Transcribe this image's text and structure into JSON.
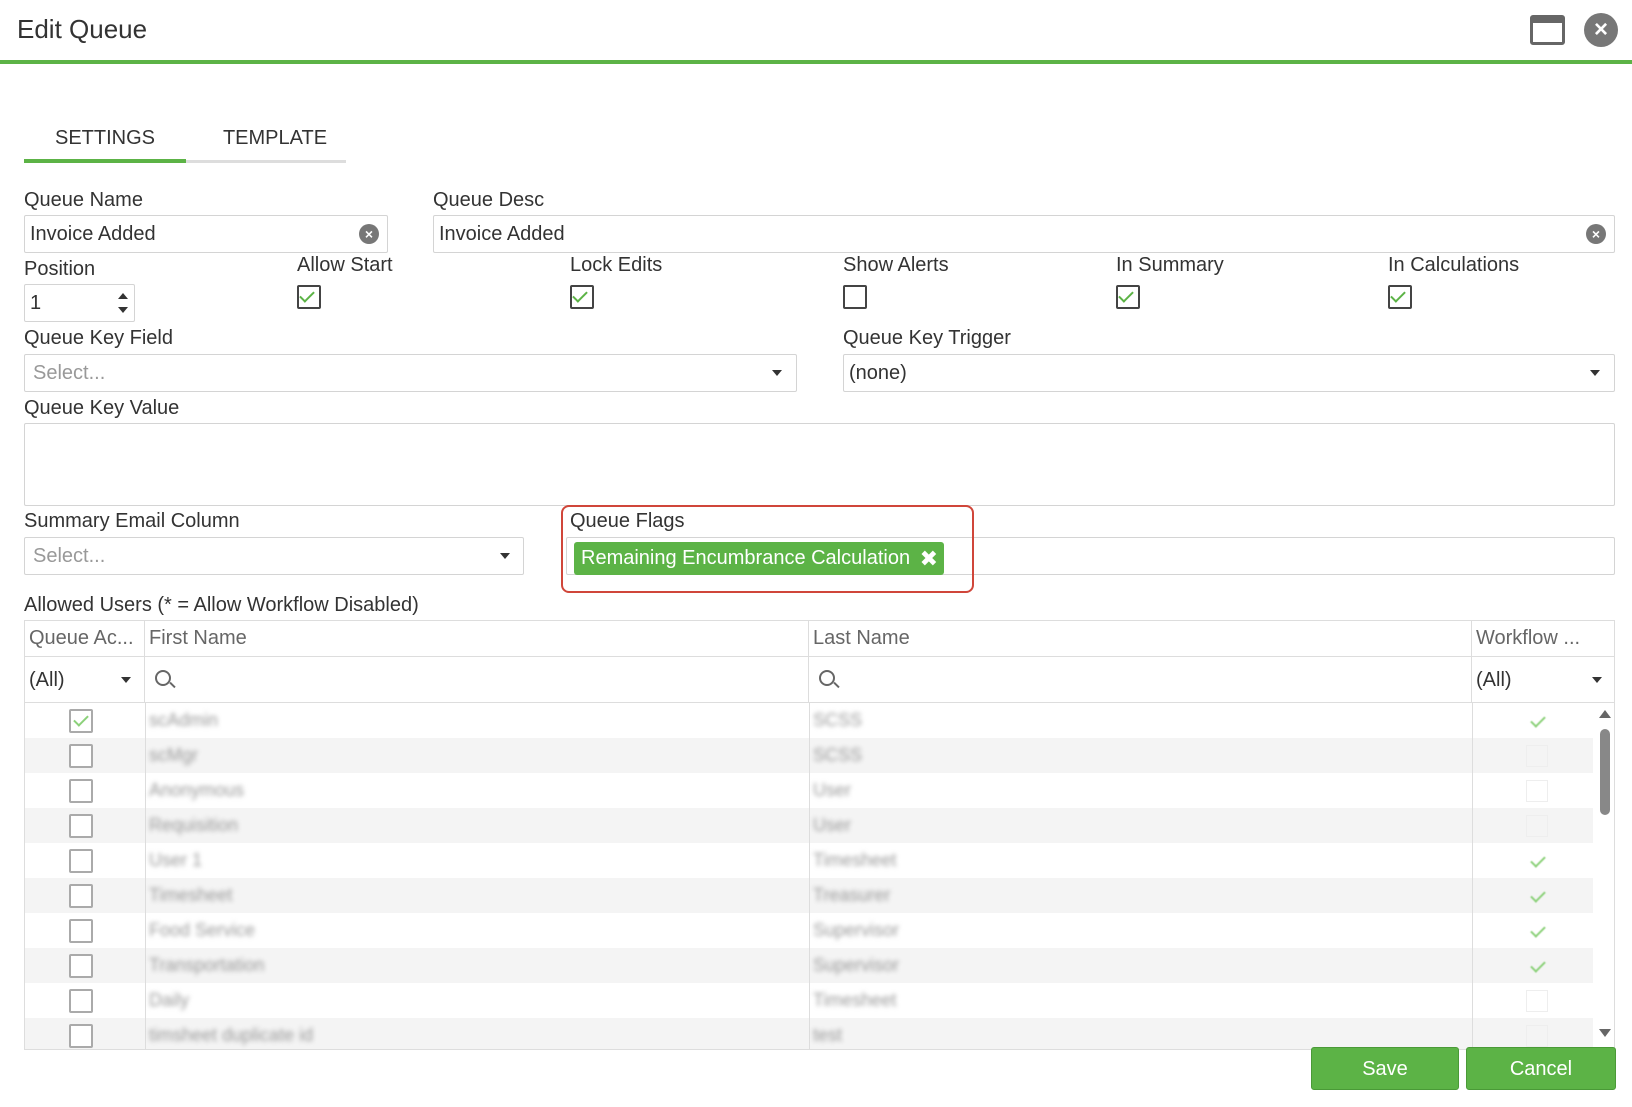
{
  "window": {
    "title": "Edit Queue"
  },
  "tabs": [
    {
      "label": "SETTINGS"
    },
    {
      "label": "TEMPLATE"
    }
  ],
  "fields": {
    "queue_name": {
      "label": "Queue Name",
      "value": "Invoice Added"
    },
    "queue_desc": {
      "label": "Queue Desc",
      "value": "Invoice Added"
    },
    "position": {
      "label": "Position",
      "value": "1"
    },
    "allow_start": {
      "label": "Allow Start",
      "checked": true
    },
    "lock_edits": {
      "label": "Lock Edits",
      "checked": true
    },
    "show_alerts": {
      "label": "Show Alerts",
      "checked": false
    },
    "in_summary": {
      "label": "In Summary",
      "checked": true
    },
    "in_calculations": {
      "label": "In Calculations",
      "checked": true
    },
    "queue_key_field": {
      "label": "Queue Key Field",
      "placeholder": "Select..."
    },
    "queue_key_trigger": {
      "label": "Queue Key Trigger",
      "value": "(none)"
    },
    "queue_key_value": {
      "label": "Queue Key Value",
      "value": ""
    },
    "summary_email_column": {
      "label": "Summary Email Column",
      "placeholder": "Select..."
    },
    "queue_flags": {
      "label": "Queue Flags",
      "tags": [
        "Remaining Encumbrance Calculation"
      ]
    }
  },
  "allowed_users": {
    "label": "Allowed Users (* = Allow Workflow Disabled)",
    "columns": [
      "Queue Ac...",
      "First Name",
      "Last Name",
      "Workflow ..."
    ],
    "filters": {
      "queue_access": "(All)",
      "workflow": "(All)"
    },
    "rows": [
      {
        "access": true,
        "first": "scAdmin",
        "last": "SCSS",
        "workflow": true
      },
      {
        "access": false,
        "first": "scMgr",
        "last": "SCSS",
        "workflow": false
      },
      {
        "access": false,
        "first": "Anonymous",
        "last": "User",
        "workflow": false
      },
      {
        "access": false,
        "first": "Requisition",
        "last": "User",
        "workflow": false
      },
      {
        "access": false,
        "first": "User 1",
        "last": "Timesheet",
        "workflow": true
      },
      {
        "access": false,
        "first": "Timesheet",
        "last": "Treasurer",
        "workflow": true
      },
      {
        "access": false,
        "first": "Food Service",
        "last": "Supervisor",
        "workflow": true
      },
      {
        "access": false,
        "first": "Transportation",
        "last": "Supervisor",
        "workflow": true
      },
      {
        "access": false,
        "first": "Daily",
        "last": "Timesheet",
        "workflow": false
      },
      {
        "access": false,
        "first": "timsheet duplicate id",
        "last": "test",
        "workflow": false
      }
    ]
  },
  "buttons": {
    "save": "Save",
    "cancel": "Cancel"
  },
  "colors": {
    "accent": "#5cb346",
    "highlight": "#d0463a"
  }
}
